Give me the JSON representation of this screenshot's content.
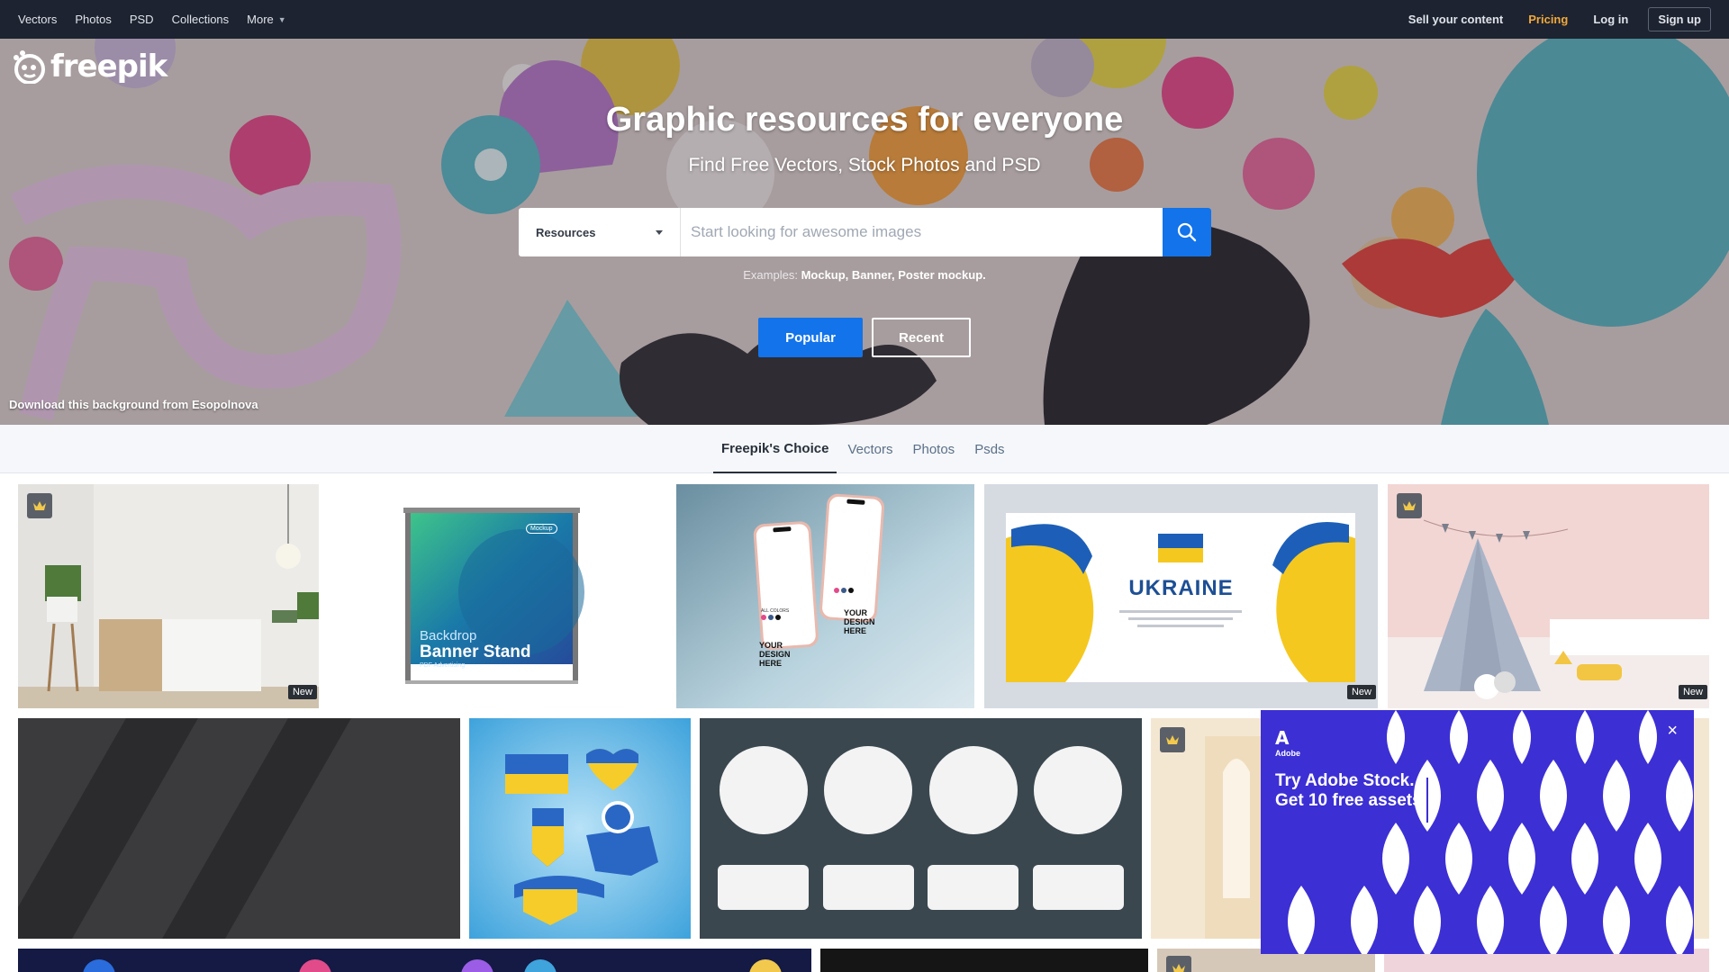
{
  "nav": {
    "left": [
      {
        "label": "Vectors"
      },
      {
        "label": "Photos"
      },
      {
        "label": "PSD"
      },
      {
        "label": "Collections"
      },
      {
        "label": "More"
      }
    ],
    "sell": "Sell your content",
    "pricing": "Pricing",
    "login": "Log in",
    "signup": "Sign up"
  },
  "brand": {
    "name": "freepik",
    "accent": "#1273eb"
  },
  "hero": {
    "title": "Graphic resources for everyone",
    "subtitle": "Find Free Vectors, Stock Photos and PSD",
    "search": {
      "type_selected": "Resources",
      "placeholder": "Start looking for awesome images",
      "icon": "search-icon"
    },
    "examples_label": "Examples:",
    "examples": [
      "Mockup,",
      "Banner,",
      "Poster mockup."
    ],
    "popular_label": "Popular",
    "recent_label": "Recent",
    "credit": "Download this background from Esopolnova"
  },
  "tabs": [
    {
      "label": "Freepik's Choice",
      "active": true
    },
    {
      "label": "Vectors"
    },
    {
      "label": "Photos"
    },
    {
      "label": "Psds"
    }
  ],
  "tiles": {
    "banner_top": "Backdrop",
    "banner_title": "Banner Stand",
    "banner_sub": "PDF Advertising",
    "banner_tag": "Mockup",
    "phone_small": "ALL COLORS",
    "phone_text": "YOUR DESIGN HERE",
    "ukraine_title": "UKRAINE",
    "new_badge": "New"
  },
  "ad": {
    "brand": "Adobe",
    "headline_1": "Try Adobe Stock.",
    "headline_2": "Get 10 free assets.",
    "close": "×"
  }
}
